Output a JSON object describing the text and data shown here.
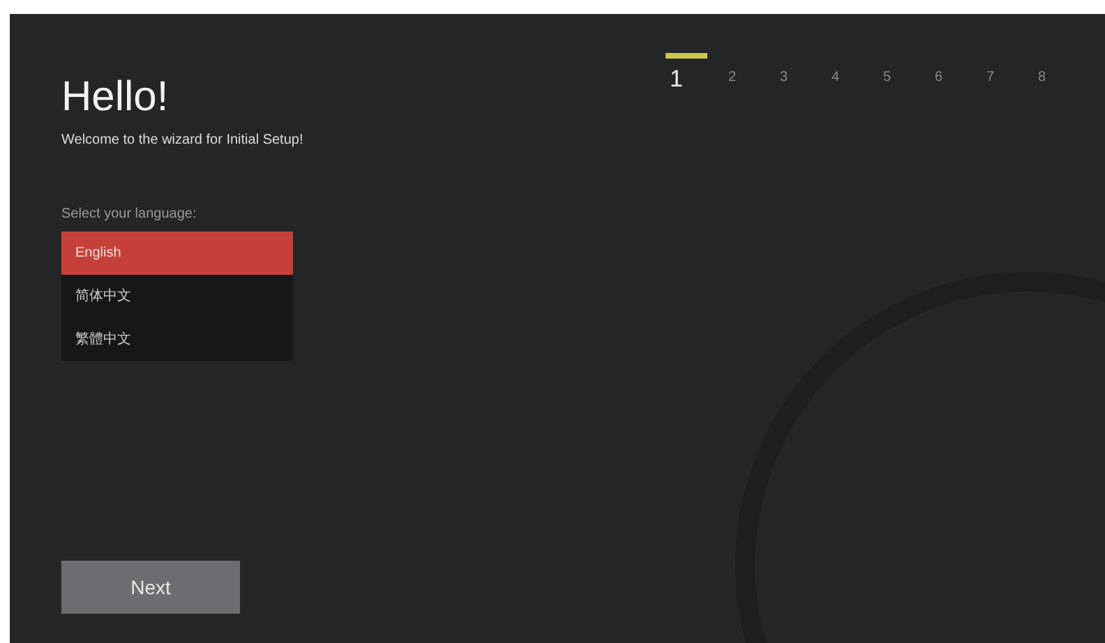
{
  "steps": [
    {
      "label": "1",
      "selected": true
    },
    {
      "label": "2",
      "selected": false
    },
    {
      "label": "3",
      "selected": false
    },
    {
      "label": "4",
      "selected": false
    },
    {
      "label": "5",
      "selected": false
    },
    {
      "label": "6",
      "selected": false
    },
    {
      "label": "7",
      "selected": false
    },
    {
      "label": "8",
      "selected": false
    }
  ],
  "title": "Hello!",
  "subtitle": "Welcome to the wizard for Initial Setup!",
  "language_prompt": "Select your language:",
  "languages": [
    {
      "label": "English",
      "selected": true
    },
    {
      "label": "简体中文",
      "selected": false
    },
    {
      "label": "繁體中文",
      "selected": false
    }
  ],
  "next_button": "Next"
}
